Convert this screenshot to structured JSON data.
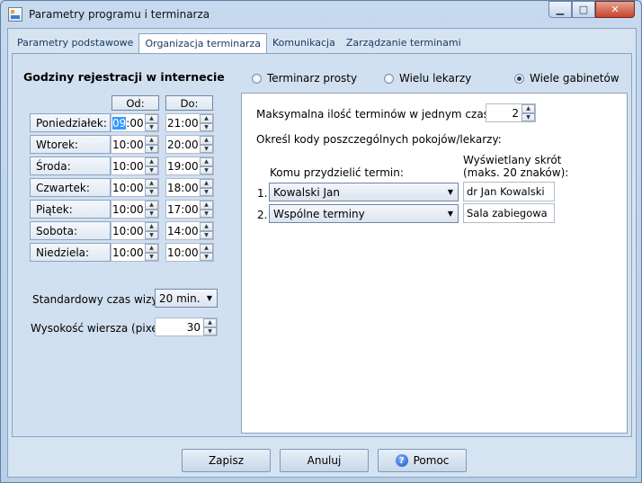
{
  "window": {
    "title": "Parametry programu i terminarza"
  },
  "tabs": [
    {
      "label": "Parametry podstawowe"
    },
    {
      "label": "Organizacja terminarza"
    },
    {
      "label": "Komunikacja"
    },
    {
      "label": "Zarządzanie terminami"
    }
  ],
  "left": {
    "heading": "Godziny rejestracji w internecie",
    "col_from": "Od:",
    "col_to": "Do:",
    "days": [
      {
        "label": "Poniedziałek:",
        "from_hour": "09",
        "from_rest": ":00",
        "to": "21:00"
      },
      {
        "label": "Wtorek:",
        "from_hour": "",
        "from_rest": "10:00",
        "to": "20:00"
      },
      {
        "label": "Środa:",
        "from_hour": "",
        "from_rest": "10:00",
        "to": "19:00"
      },
      {
        "label": "Czwartek:",
        "from_hour": "",
        "from_rest": "10:00",
        "to": "18:00"
      },
      {
        "label": "Piątek:",
        "from_hour": "",
        "from_rest": "10:00",
        "to": "17:00"
      },
      {
        "label": "Sobota:",
        "from_hour": "",
        "from_rest": "10:00",
        "to": "14:00"
      },
      {
        "label": "Niedziela:",
        "from_hour": "",
        "from_rest": "10:00",
        "to": "10:00"
      }
    ],
    "visit_time_label": "Standardowy czas wizyty:",
    "visit_time_value": "20 min.",
    "row_height_label": "Wysokość wiersza (pixele):",
    "row_height_value": "30"
  },
  "right": {
    "radios": [
      {
        "label": "Terminarz prosty",
        "checked": false
      },
      {
        "label": "Wielu lekarzy",
        "checked": false
      },
      {
        "label": "Wiele gabinetów",
        "checked": true
      }
    ],
    "max_label": "Maksymalna ilość terminów w jednym czasie:",
    "max_value": "2",
    "codes_label": "Określ kody poszczególnych pokojów/lekarzy:",
    "assign_header": "Komu przydzielić termin:",
    "short_header_1": "Wyświetlany skrót",
    "short_header_2": "(maks. 20 znaków):",
    "rows": [
      {
        "num": "1.",
        "assign": "Kowalski Jan",
        "short": "dr Jan Kowalski"
      },
      {
        "num": "2.",
        "assign": "Wspólne terminy",
        "short": "Sala zabiegowa"
      }
    ]
  },
  "buttons": {
    "save": "Zapisz",
    "cancel": "Anuluj",
    "help": "Pomoc"
  }
}
